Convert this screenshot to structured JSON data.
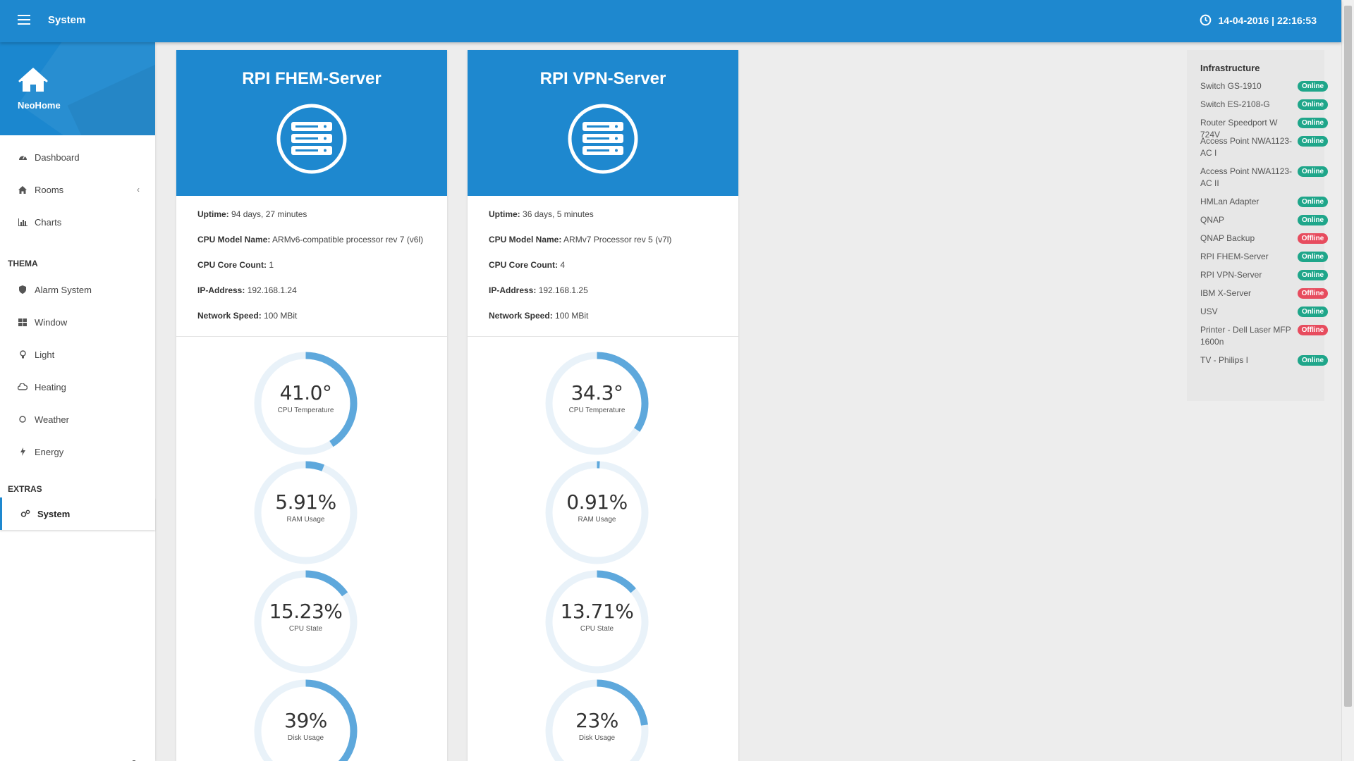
{
  "topbar": {
    "title": "System",
    "datetime": "14-04-2016 | 22:16:53"
  },
  "sidebar": {
    "brand": "NeoHome",
    "items": [
      {
        "label": "Dashboard",
        "icon": "dashboard-icon"
      },
      {
        "label": "Rooms",
        "icon": "home-icon",
        "has_submenu": true
      },
      {
        "label": "Charts",
        "icon": "bar-chart-icon"
      }
    ],
    "sections": [
      {
        "label": "THEMA",
        "items": [
          {
            "label": "Alarm System",
            "icon": "shield-icon"
          },
          {
            "label": "Window",
            "icon": "window-icon"
          },
          {
            "label": "Light",
            "icon": "lightbulb-icon"
          },
          {
            "label": "Heating",
            "icon": "cloud-icon"
          },
          {
            "label": "Weather",
            "icon": "sun-icon"
          },
          {
            "label": "Energy",
            "icon": "bolt-icon"
          }
        ]
      },
      {
        "label": "EXTRAS",
        "items": [
          {
            "label": "System",
            "icon": "cogs-icon",
            "active": true
          }
        ]
      }
    ]
  },
  "servers": [
    {
      "name": "RPI FHEM-Server",
      "info": [
        {
          "key": "Uptime:",
          "value": "94 days, 27 minutes"
        },
        {
          "key": "CPU Model Name:",
          "value": "ARMv6-compatible processor rev 7 (v6l)"
        },
        {
          "key": "CPU Core Count:",
          "value": "1"
        },
        {
          "key": "IP-Address:",
          "value": "192.168.1.24"
        },
        {
          "key": "Network Speed:",
          "value": "100 MBit"
        }
      ],
      "gauges": [
        {
          "value": "41.0°",
          "label": "CPU Temperature",
          "fraction": 0.41
        },
        {
          "value": "5.91%",
          "label": "RAM Usage",
          "fraction": 0.0591
        },
        {
          "value": "15.23%",
          "label": "CPU State",
          "fraction": 0.1523
        },
        {
          "value": "39%",
          "label": "Disk Usage",
          "fraction": 0.39
        }
      ]
    },
    {
      "name": "RPI VPN-Server",
      "info": [
        {
          "key": "Uptime:",
          "value": "36 days, 5 minutes"
        },
        {
          "key": "CPU Model Name:",
          "value": "ARMv7 Processor rev 5 (v7l)"
        },
        {
          "key": "CPU Core Count:",
          "value": "4"
        },
        {
          "key": "IP-Address:",
          "value": "192.168.1.25"
        },
        {
          "key": "Network Speed:",
          "value": "100 MBit"
        }
      ],
      "gauges": [
        {
          "value": "34.3°",
          "label": "CPU Temperature",
          "fraction": 0.343
        },
        {
          "value": "0.91%",
          "label": "RAM Usage",
          "fraction": 0.0091
        },
        {
          "value": "13.71%",
          "label": "CPU State",
          "fraction": 0.1371
        },
        {
          "value": "23%",
          "label": "Disk Usage",
          "fraction": 0.23
        }
      ]
    }
  ],
  "infrastructure": {
    "title": "Infrastructure",
    "devices": [
      {
        "name": "Switch GS-1910",
        "status": "Online"
      },
      {
        "name": "Switch ES-2108-G",
        "status": "Online"
      },
      {
        "name": "Router Speedport W 724V",
        "status": "Online"
      },
      {
        "name": "Access Point NWA1123-AC I",
        "status": "Online"
      },
      {
        "name": "Access Point NWA1123-AC II",
        "status": "Online"
      },
      {
        "name": "HMLan Adapter",
        "status": "Online"
      },
      {
        "name": "QNAP",
        "status": "Online"
      },
      {
        "name": "QNAP Backup",
        "status": "Offline"
      },
      {
        "name": "RPI FHEM-Server",
        "status": "Online"
      },
      {
        "name": "RPI VPN-Server",
        "status": "Online"
      },
      {
        "name": "IBM X-Server",
        "status": "Offline"
      },
      {
        "name": "USV",
        "status": "Online"
      },
      {
        "name": "Printer - Dell Laser MFP 1600n",
        "status": "Offline"
      },
      {
        "name": "TV - Philips I",
        "status": "Online"
      }
    ]
  },
  "colors": {
    "primary": "#1e88cf",
    "gauge_fill": "#5ea8dc",
    "gauge_track": "#e9f2f9",
    "online": "#1fa68a",
    "offline": "#e74c5e"
  }
}
